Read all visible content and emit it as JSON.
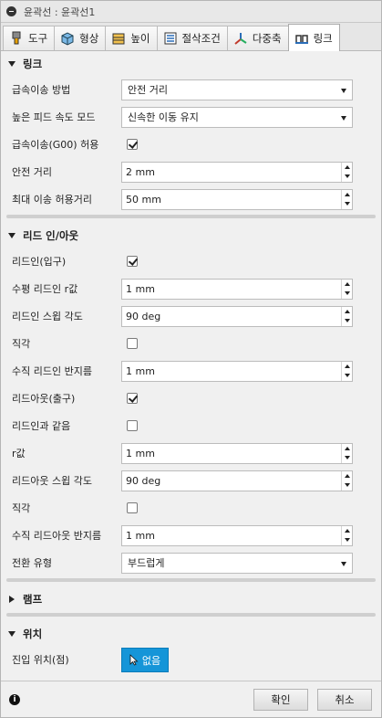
{
  "title": "윤곽선 : 윤곽선1",
  "tabs": [
    {
      "label": "도구",
      "icon": "tool-icon"
    },
    {
      "label": "형상",
      "icon": "geometry-icon"
    },
    {
      "label": "높이",
      "icon": "heights-icon"
    },
    {
      "label": "절삭조건",
      "icon": "passes-icon"
    },
    {
      "label": "다중축",
      "icon": "multiaxis-icon"
    },
    {
      "label": "링크",
      "icon": "linking-icon",
      "active": true
    }
  ],
  "sections": {
    "linking": {
      "title": "링크",
      "rapid_method": {
        "label": "급속이송 방법",
        "value": "안전 거리"
      },
      "high_feed_mode": {
        "label": "높은 피드 속도 모드",
        "value": "신속한 이동 유지"
      },
      "allow_rapid": {
        "label": "급속이송(G00) 허용",
        "checked": true
      },
      "safe_distance": {
        "label": "안전 거리",
        "value": "2 mm"
      },
      "max_stay_down": {
        "label": "최대 이송 허용거리",
        "value": "50 mm"
      }
    },
    "leads": {
      "title": "리드 인/아웃",
      "lead_in": {
        "label": "리드인(입구)",
        "checked": true
      },
      "horizontal_radius": {
        "label": "수평 리드인 r값",
        "value": "1 mm"
      },
      "sweep_angle": {
        "label": "리드인 스윕 각도",
        "value": "90 deg"
      },
      "perpendicular": {
        "label": "직각",
        "checked": false
      },
      "vertical_radius": {
        "label": "수직 리드인 반지름",
        "value": "1 mm"
      },
      "lead_out": {
        "label": "리드아웃(출구)",
        "checked": true
      },
      "same_as_lead_in": {
        "label": "리드인과 같음",
        "checked": false
      },
      "out_radius": {
        "label": "r값",
        "value": "1 mm"
      },
      "out_sweep_angle": {
        "label": "리드아웃 스윕 각도",
        "value": "90 deg"
      },
      "out_perpendicular": {
        "label": "직각",
        "checked": false
      },
      "out_vertical_radius": {
        "label": "수직 리드아웃 반지름",
        "value": "1 mm"
      },
      "transition_type": {
        "label": "전환 유형",
        "value": "부드럽게"
      }
    },
    "ramp": {
      "title": "램프"
    },
    "positions": {
      "title": "위치",
      "entry_position": {
        "label": "진입 위치(점)",
        "button": "없음"
      }
    }
  },
  "footer": {
    "ok": "확인",
    "cancel": "취소"
  },
  "colors": {
    "accent": "#1595d8",
    "panel": "#f0f0f0"
  }
}
